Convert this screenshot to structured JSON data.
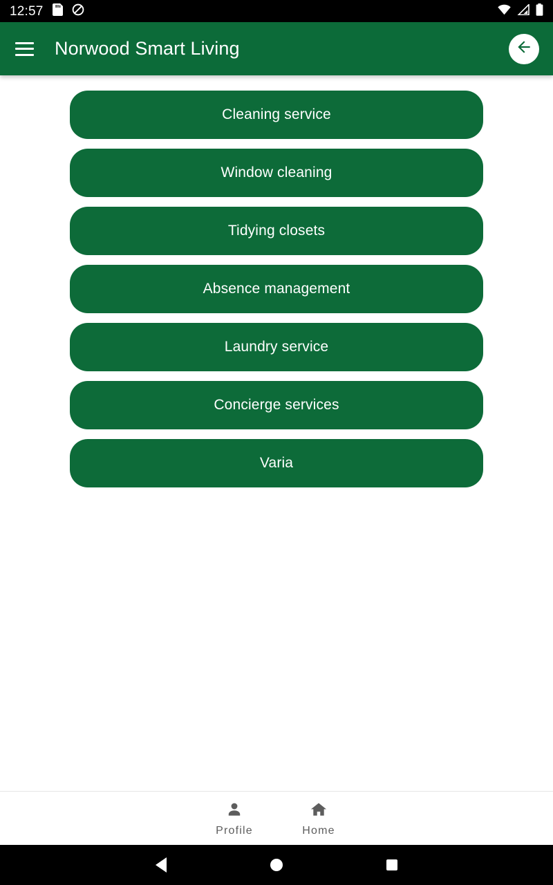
{
  "status_bar": {
    "clock": "12:57",
    "left_icons": [
      "sd-card-icon",
      "do-not-disturb-icon"
    ],
    "right_icons": [
      "wifi-icon",
      "cellular-signal-icon",
      "battery-icon"
    ],
    "background_color": "#000000",
    "foreground_color": "#ffffff"
  },
  "app_bar": {
    "title": "Norwood Smart Living",
    "menu_icon": "hamburger-menu-icon",
    "back_icon": "arrow-back-circle-icon",
    "background_color": "#0c6b39",
    "text_color": "#ffffff"
  },
  "main": {
    "buttons": [
      {
        "label": "Cleaning service"
      },
      {
        "label": "Window cleaning"
      },
      {
        "label": "Tidying closets"
      },
      {
        "label": "Absence management"
      },
      {
        "label": "Laundry service"
      },
      {
        "label": "Concierge services"
      },
      {
        "label": "Varia"
      }
    ],
    "button_color": "#0d6b39",
    "button_text_color": "#ffffff",
    "background_color": "#ffffff"
  },
  "bottom_nav": {
    "items": [
      {
        "label": "Profile",
        "icon": "person-icon"
      },
      {
        "label": "Home",
        "icon": "house-icon"
      }
    ],
    "color": "#5d5d5d",
    "background_color": "#ffffff"
  },
  "system_nav": {
    "buttons": [
      "back-triangle-icon",
      "home-circle-icon",
      "recents-square-icon"
    ],
    "background_color": "#000000"
  }
}
